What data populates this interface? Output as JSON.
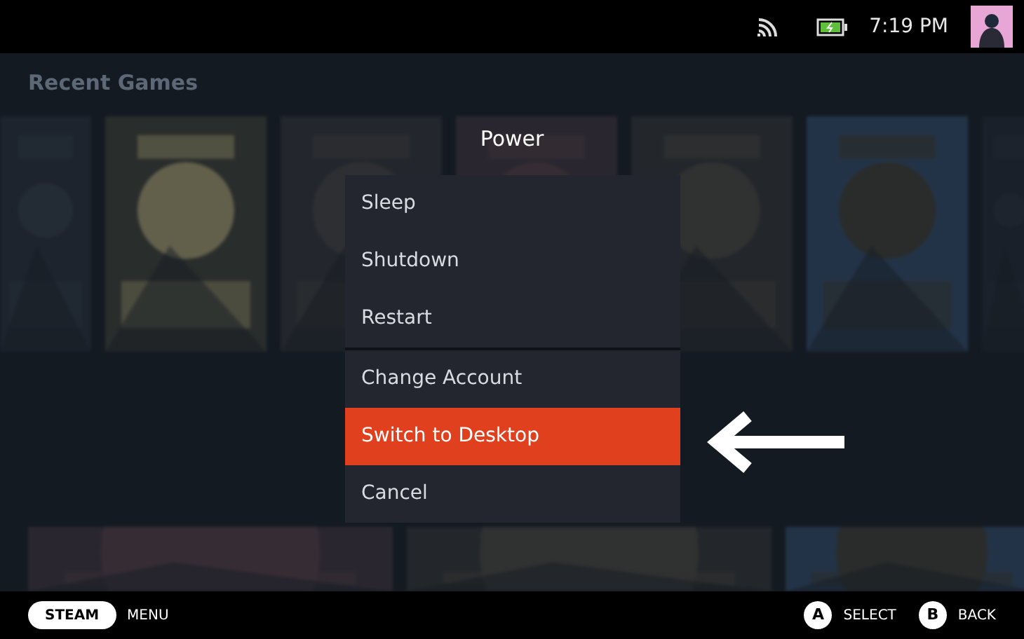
{
  "status_bar": {
    "time": "7:19 PM"
  },
  "background": {
    "heading": "Recent Games"
  },
  "dialog": {
    "title": "Power",
    "groups": [
      [
        {
          "label": "Sleep",
          "selected": false
        },
        {
          "label": "Shutdown",
          "selected": false
        },
        {
          "label": "Restart",
          "selected": false
        }
      ],
      [
        {
          "label": "Change Account",
          "selected": false
        },
        {
          "label": "Switch to Desktop",
          "selected": true
        },
        {
          "label": "Cancel",
          "selected": false
        }
      ]
    ]
  },
  "footer": {
    "left": [
      {
        "key": "STEAM",
        "label": "MENU"
      }
    ],
    "right": [
      {
        "key": "A",
        "label": "SELECT"
      },
      {
        "key": "B",
        "label": "BACK"
      }
    ]
  }
}
